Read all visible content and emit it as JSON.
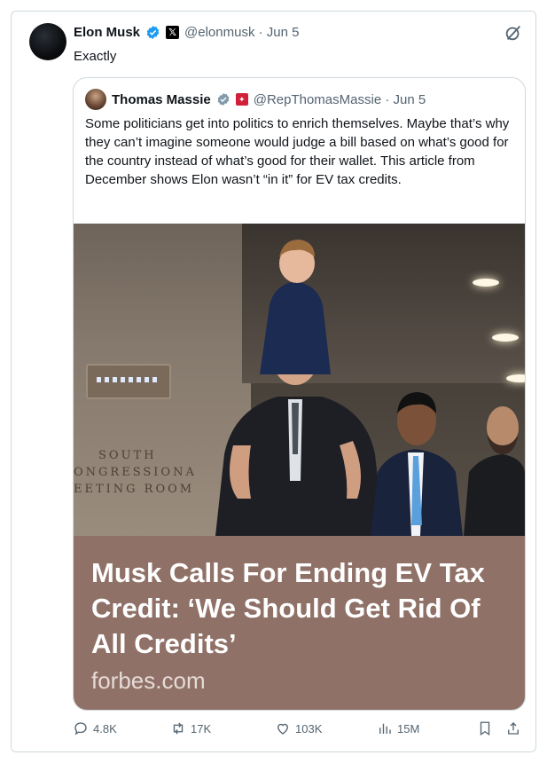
{
  "tweet": {
    "author_name": "Elon Musk",
    "handle_date": "@elonmusk · Jun 5",
    "text": "Exactly",
    "avatar_icon": "avatar-dark-circle",
    "grok_icon": "grok-icon"
  },
  "quote": {
    "author_name": "Thomas Massie",
    "handle_date": "@RepThomasMassie · Jun 5",
    "text": "Some politicians get into politics to enrich themselves. Maybe that’s why they can’t imagine someone would judge a bill based on what’s good for the country instead of what’s good for their wallet. This article from December shows Elon wasn’t “in it” for EV tax credits.",
    "photo_sign_lines": [
      "SOUTH",
      "ONGRESSIONA",
      "EETING ROOM"
    ],
    "card_title": "Musk Calls For Ending EV Tax Credit: ‘We Should Get Rid Of All Credits’",
    "card_domain": "forbes.com",
    "card_color": "#8f7167"
  },
  "actions": {
    "replies": "4.8K",
    "reposts": "17K",
    "likes": "103K",
    "views": "15M"
  },
  "colors": {
    "verified": "#1d9bf0",
    "muted_text": "#536471",
    "border": "#cfd9de"
  }
}
